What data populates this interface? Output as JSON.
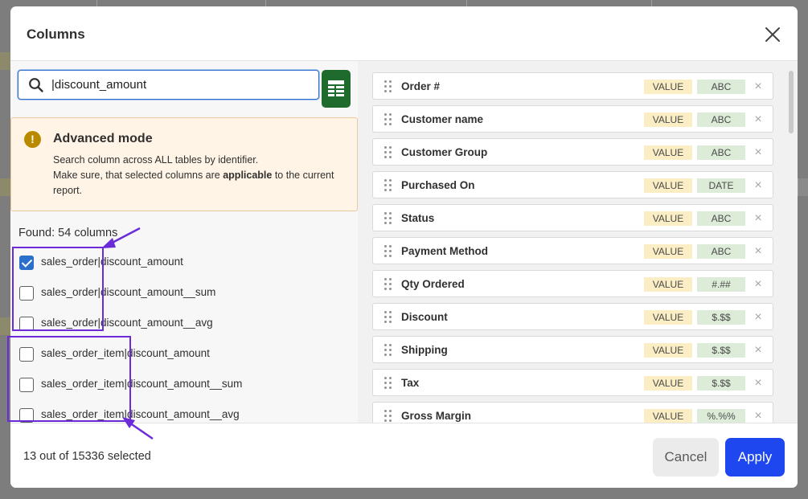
{
  "modal": {
    "title": "Columns"
  },
  "search": {
    "value": "|discount_amount",
    "icon": "search-icon"
  },
  "sheet_button": {
    "icon": "spreadsheet-icon",
    "color": "#1e6b2d"
  },
  "banner": {
    "icon": "warning-icon",
    "title": "Advanced mode",
    "line1": "Search column across ALL tables by identifier.",
    "line2_prefix": "Make sure, that selected columns are ",
    "line2_bold": "applicable",
    "line2_suffix": " to the current",
    "line3": "report."
  },
  "results": {
    "found_label": "Found: 54 columns",
    "items": [
      {
        "label": "sales_order|discount_amount",
        "checked": true
      },
      {
        "label": "sales_order|discount_amount__sum",
        "checked": false
      },
      {
        "label": "sales_order|discount_amount__avg",
        "checked": false
      },
      {
        "label": "sales_order_item|discount_amount",
        "checked": false
      },
      {
        "label": "sales_order_item|discount_amount__sum",
        "checked": false
      },
      {
        "label": "sales_order_item|discount_amount__avg",
        "checked": false
      }
    ]
  },
  "columns": [
    {
      "name": "Order #",
      "kind": "VALUE",
      "type": "ABC"
    },
    {
      "name": "Customer name",
      "kind": "VALUE",
      "type": "ABC"
    },
    {
      "name": "Customer Group",
      "kind": "VALUE",
      "type": "ABC"
    },
    {
      "name": "Purchased On",
      "kind": "VALUE",
      "type": "DATE"
    },
    {
      "name": "Status",
      "kind": "VALUE",
      "type": "ABC"
    },
    {
      "name": "Payment Method",
      "kind": "VALUE",
      "type": "ABC"
    },
    {
      "name": "Qty Ordered",
      "kind": "VALUE",
      "type": "#.##"
    },
    {
      "name": "Discount",
      "kind": "VALUE",
      "type": "$.$$"
    },
    {
      "name": "Shipping",
      "kind": "VALUE",
      "type": "$.$$"
    },
    {
      "name": "Tax",
      "kind": "VALUE",
      "type": "$.$$"
    },
    {
      "name": "Gross Margin",
      "kind": "VALUE",
      "type": "%.%%"
    }
  ],
  "footer": {
    "selected_text": "13 out of 15336 selected",
    "cancel_label": "Cancel",
    "apply_label": "Apply"
  },
  "colors": {
    "accent": "#2c6ecb",
    "apply": "#1f47f0",
    "annotation": "#6c2bd9",
    "value_tag": "#fbeec4",
    "type_tag": "#dcecd8",
    "banner_bg": "#fff4e5"
  }
}
